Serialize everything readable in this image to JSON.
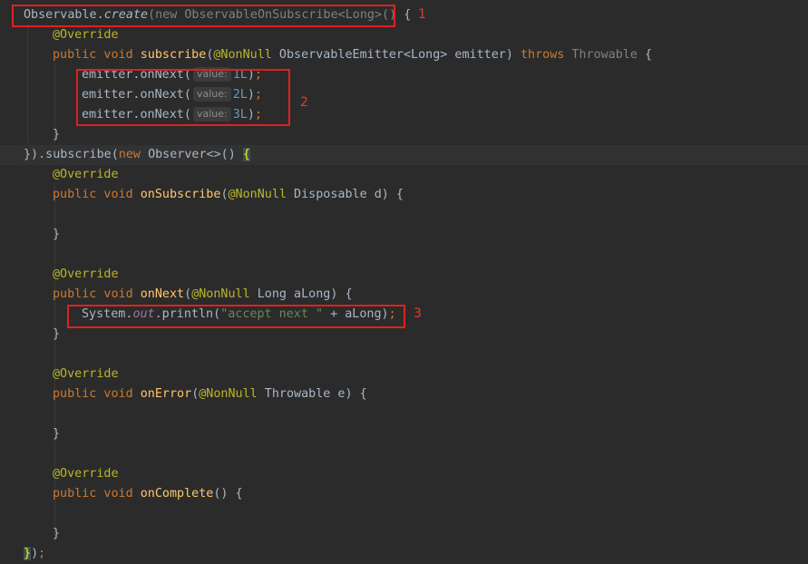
{
  "editor": {
    "lines": [
      [
        [
          "",
          "Observable."
        ],
        [
          "it",
          "create"
        ],
        [
          "gr",
          "(new ObservableOnSubscribe<Long>()"
        ],
        [
          "",
          " {"
        ]
      ],
      [
        [
          "ann",
          "@Override"
        ]
      ],
      [
        [
          "kw",
          "public void "
        ],
        [
          "fn",
          "subscribe"
        ],
        [
          "",
          "("
        ],
        [
          "ann",
          "@NonNull"
        ],
        [
          "",
          " ObservableEmitter<Long> emitter) "
        ],
        [
          "kw",
          "throws "
        ],
        [
          "gr",
          "Throwable"
        ],
        [
          "",
          " {"
        ]
      ],
      [
        [
          "",
          "emitter.onNext("
        ],
        [
          "hint",
          "value:"
        ],
        [
          "num",
          "1L"
        ],
        [
          "",
          ")"
        ],
        [
          "kw",
          ";"
        ]
      ],
      [
        [
          "",
          "emitter.onNext("
        ],
        [
          "hint",
          "value:"
        ],
        [
          "num",
          "2L"
        ],
        [
          "",
          ")"
        ],
        [
          "kw",
          ";"
        ]
      ],
      [
        [
          "",
          "emitter.onNext("
        ],
        [
          "hint",
          "value:"
        ],
        [
          "num",
          "3L"
        ],
        [
          "",
          ")"
        ],
        [
          "kw",
          ";"
        ]
      ],
      [
        [
          "",
          "}"
        ]
      ],
      [
        [
          "",
          "}).subscribe("
        ],
        [
          "kw",
          "new "
        ],
        [
          "",
          "Observer<>() "
        ],
        [
          "br",
          "{"
        ]
      ],
      [
        [
          "ann",
          "@Override"
        ]
      ],
      [
        [
          "kw",
          "public void "
        ],
        [
          "fn",
          "onSubscribe"
        ],
        [
          "",
          "("
        ],
        [
          "ann",
          "@NonNull"
        ],
        [
          "",
          " Disposable d) {"
        ]
      ],
      [],
      [
        [
          "",
          "}"
        ]
      ],
      [],
      [
        [
          "ann",
          "@Override"
        ]
      ],
      [
        [
          "kw",
          "public void "
        ],
        [
          "fn",
          "onNext"
        ],
        [
          "",
          "("
        ],
        [
          "ann",
          "@NonNull"
        ],
        [
          "",
          " Long aLong) {"
        ]
      ],
      [
        [
          "",
          "System."
        ],
        [
          "st",
          "out"
        ],
        [
          "",
          ".println("
        ],
        [
          "str",
          "\"accept next \""
        ],
        [
          "",
          " + aLong)"
        ],
        [
          "kw",
          ";"
        ]
      ],
      [
        [
          "",
          "}"
        ]
      ],
      [],
      [
        [
          "ann",
          "@Override"
        ]
      ],
      [
        [
          "kw",
          "public void "
        ],
        [
          "fn",
          "onError"
        ],
        [
          "",
          "("
        ],
        [
          "ann",
          "@NonNull"
        ],
        [
          "",
          " Throwable e) {"
        ]
      ],
      [],
      [
        [
          "",
          "}"
        ]
      ],
      [],
      [
        [
          "ann",
          "@Override"
        ]
      ],
      [
        [
          "kw",
          "public void "
        ],
        [
          "fn",
          "onComplete"
        ],
        [
          "",
          "() {"
        ]
      ],
      [],
      [
        [
          "",
          "}"
        ]
      ],
      [
        [
          "br",
          "}"
        ],
        [
          "",
          ")"
        ],
        [
          "kw",
          ";"
        ]
      ]
    ]
  },
  "annotations": {
    "box1": "1",
    "box2": "2",
    "box3": "3"
  }
}
